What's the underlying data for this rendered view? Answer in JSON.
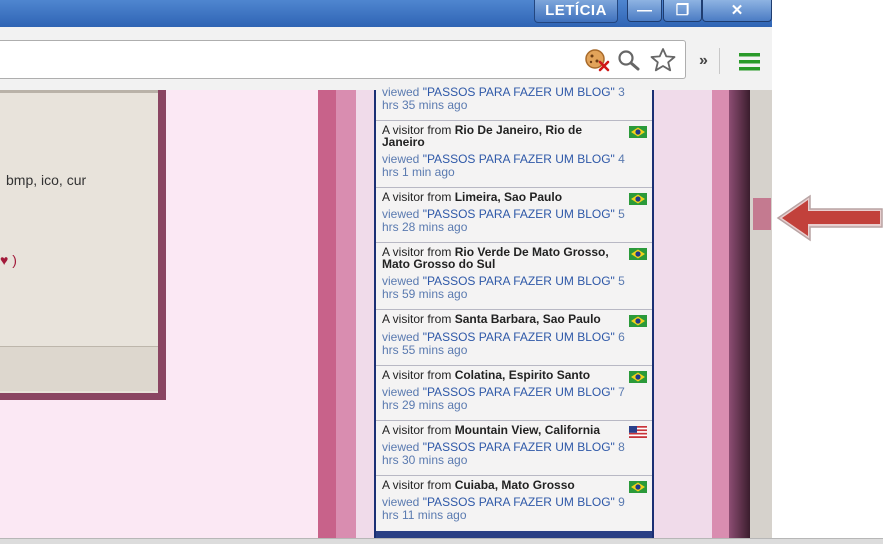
{
  "titlebar": {
    "user_label": "LETÍCIA",
    "minimize_glyph": "—",
    "restore_glyph": "❐",
    "close_glyph": "✕"
  },
  "toolbar": {
    "overflow_glyph": "»"
  },
  "left_panel": {
    "line1": "bmp, ico, cur",
    "line2": "♥ )"
  },
  "feed": {
    "first_partial": {
      "viewed_prefix": "viewed ",
      "title": "\"PASSOS PARA FAZER UM BLOG\"",
      "suffix": " 3",
      "ago": "hrs 35 mins ago"
    },
    "items": [
      {
        "prefix": "A visitor from ",
        "place": "Rio De Janeiro, Rio de Janeiro",
        "flag": "brazil",
        "viewed_prefix": "viewed ",
        "title": "\"PASSOS PARA FAZER UM BLOG\"",
        "suffix": " 4",
        "ago": "hrs 1 min ago"
      },
      {
        "prefix": "A visitor from ",
        "place": "Limeira, Sao Paulo",
        "flag": "brazil",
        "viewed_prefix": "viewed ",
        "title": "\"PASSOS PARA FAZER UM BLOG\"",
        "suffix": " 5",
        "ago": "hrs 28 mins ago"
      },
      {
        "prefix": "A visitor from ",
        "place": "Rio Verde De Mato Grosso, Mato Grosso do Sul",
        "flag": "brazil",
        "viewed_prefix": "viewed ",
        "title": "\"PASSOS PARA FAZER UM BLOG\"",
        "suffix": " 5",
        "ago": "hrs 59 mins ago"
      },
      {
        "prefix": "A visitor from ",
        "place": "Santa Barbara, Sao Paulo",
        "flag": "brazil",
        "viewed_prefix": "viewed ",
        "title": "\"PASSOS PARA FAZER UM BLOG\"",
        "suffix": " 6",
        "ago": "hrs 55 mins ago"
      },
      {
        "prefix": "A visitor from ",
        "place": "Colatina, Espirito Santo",
        "flag": "brazil",
        "viewed_prefix": "viewed ",
        "title": "\"PASSOS PARA FAZER UM BLOG\"",
        "suffix": " 7",
        "ago": "hrs 29 mins ago"
      },
      {
        "prefix": "A visitor from ",
        "place": "Mountain View, California",
        "flag": "usa",
        "viewed_prefix": "viewed ",
        "title": "\"PASSOS PARA FAZER UM BLOG\"",
        "suffix": " 8",
        "ago": "hrs 30 mins ago"
      },
      {
        "prefix": "A visitor from ",
        "place": "Cuiaba, Mato Grosso",
        "flag": "brazil",
        "viewed_prefix": "viewed ",
        "title": "\"PASSOS PARA FAZER UM BLOG\"",
        "suffix": " 9",
        "ago": "hrs 11 mins ago"
      }
    ]
  },
  "colors": {
    "titlebar": "#2f64b4",
    "scroll_thumb": "#c47a90",
    "arrow": "#c2413b",
    "feed_border": "#1b2f74",
    "link": "#2e58a8"
  }
}
